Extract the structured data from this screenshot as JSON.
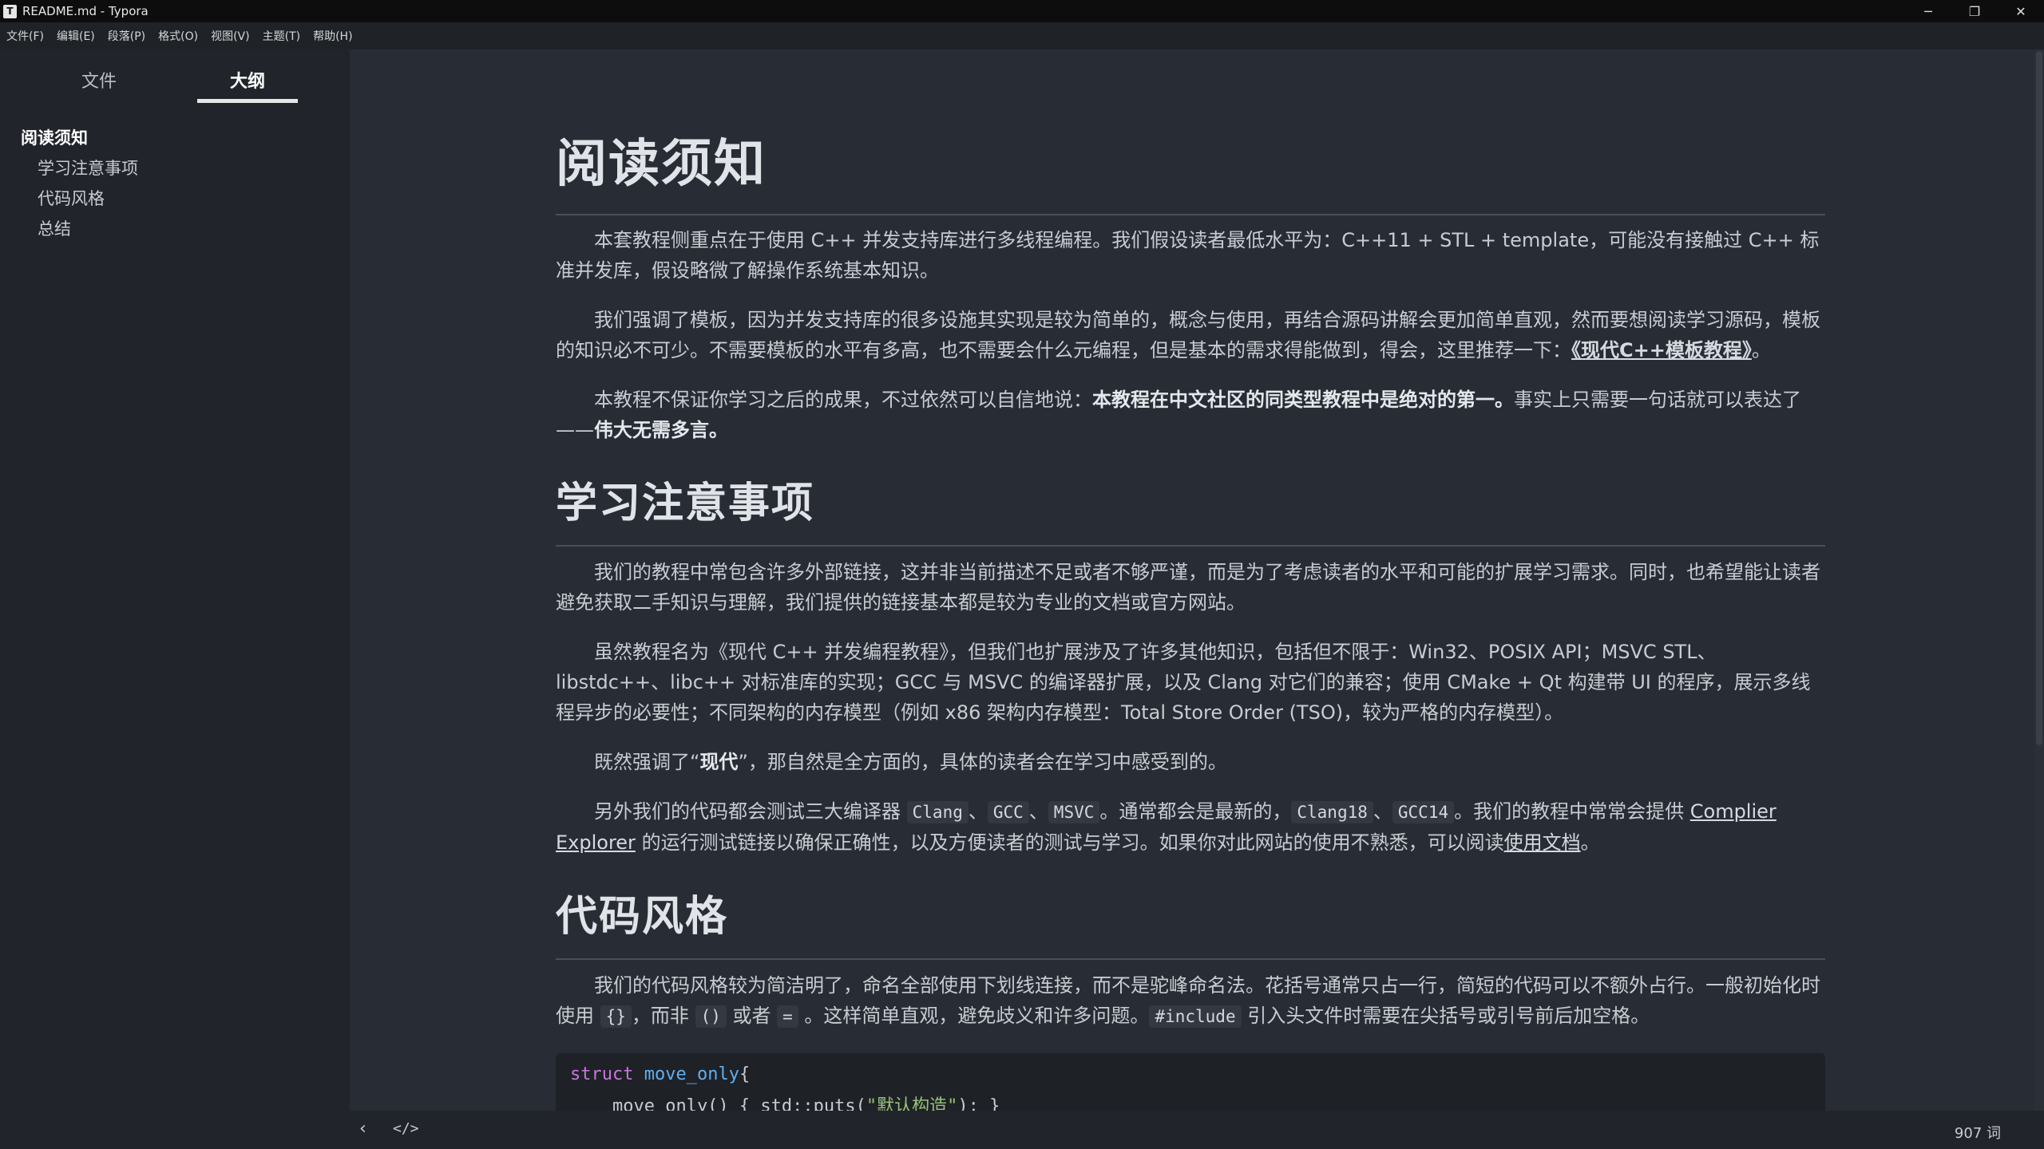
{
  "window": {
    "title": "README.md - Typora",
    "app_icon": "T",
    "controls": {
      "minimize": "─",
      "restore": "❐",
      "close": "✕"
    }
  },
  "menu": [
    "文件(F)",
    "编辑(E)",
    "段落(P)",
    "格式(O)",
    "视图(V)",
    "主题(T)",
    "帮助(H)"
  ],
  "sidebar": {
    "tabs": {
      "files": "文件",
      "outline": "大纲"
    },
    "active_tab": "outline",
    "outline": [
      {
        "label": "阅读须知",
        "level": 1
      },
      {
        "label": "学习注意事项",
        "level": 2
      },
      {
        "label": "代码风格",
        "level": 2
      },
      {
        "label": "总结",
        "level": 2
      }
    ]
  },
  "doc": {
    "h1": "阅读须知",
    "p1": "本套教程侧重点在于使用 C++ 并发支持库进行多线程编程。我们假设读者最低水平为：C++11 + STL + template，可能没有接触过 C++ 标准并发库，假设略微了解操作系统基本知识。",
    "p2_text": "我们强调了模板，因为并发支持库的很多设施其实现是较为简单的，概念与使用，再结合源码讲解会更加简单直观，然而要想阅读学习源码，模板的知识必不可少。不需要模板的水平有多高，也不需要会什么元编程，但是基本的需求得能做到，得会，这里推荐一下：",
    "p2_link": "《现代C++模板教程》",
    "p2_end": "。",
    "p3_text": "本教程不保证你学习之后的成果，不过依然可以自信地说：",
    "p3_bold": "本教程在中文社区的同类型教程中是绝对的第一。",
    "p3_mid": "事实上只需要一句话就可以表达了——",
    "p3_bold2": "伟大无需多言。",
    "h2_1": "学习注意事项",
    "p4": "我们的教程中常包含许多外部链接，这并非当前描述不足或者不够严谨，而是为了考虑读者的水平和可能的扩展学习需求。同时，也希望能让读者避免获取二手知识与理解，我们提供的链接基本都是较为专业的文档或官方网站。",
    "p5": "虽然教程名为《现代 C++ 并发编程教程》，但我们也扩展涉及了许多其他知识，包括但不限于：Win32、POSIX API；MSVC STL、libstdc++、libc++ 对标准库的实现；GCC 与 MSVC 的编译器扩展，以及 Clang 对它们的兼容；使用 CMake + Qt 构建带 UI 的程序，展示多线程异步的必要性；不同架构的内存模型（例如 x86 架构内存模型：Total Store Order (TSO)，较为严格的内存模型）。",
    "p6_a": "既然强调了“",
    "p6_bold": "现代",
    "p6_b": "”，那自然是全方面的，具体的读者会在学习中感受到的。",
    "p7_a": "另外我们的代码都会测试三大编译器 ",
    "p7_c1": "Clang",
    "p7_sep1": "、",
    "p7_c2": "GCC",
    "p7_sep2": "、",
    "p7_c3": "MSVC",
    "p7_b": "。通常都会是最新的，",
    "p7_c4": "Clang18",
    "p7_sep3": "、",
    "p7_c5": "GCC14",
    "p7_c": "。我们的教程中常常会提供 ",
    "p7_link1": "Complier Explorer",
    "p7_d": " 的运行测试链接以确保正确性，以及方便读者的测试与学习。如果你对此网站的使用不熟悉，可以阅读",
    "p7_link2": "使用文档",
    "p7_e": "。",
    "h2_2": "代码风格",
    "p8_a": "我们的代码风格较为简洁明了，命名全部使用下划线连接，而不是驼峰命名法。花括号通常只占一行，简短的代码可以不额外占行。一般初始化时使用 ",
    "p8_c1": "{}",
    "p8_b": "，而非 ",
    "p8_c2": "()",
    "p8_mid": " 或者 ",
    "p8_c3": "=",
    "p8_c": " 。这样简单直观，避免歧义和许多问题。",
    "p8_c4": "#include",
    "p8_d": " 引入头文件时需要在尖括号或引号前后加空格。",
    "code_line1_kw": "struct",
    "code_line1_name": " move_only",
    "code_line1_rest": "{",
    "code_line2_a": "    move_only() { std::puts(",
    "code_line2_str": "\"默认构造\"",
    "code_line2_b": "); }"
  },
  "status": {
    "back_icon": "‹",
    "source_toggle": "</>",
    "word_count": "907 词"
  }
}
